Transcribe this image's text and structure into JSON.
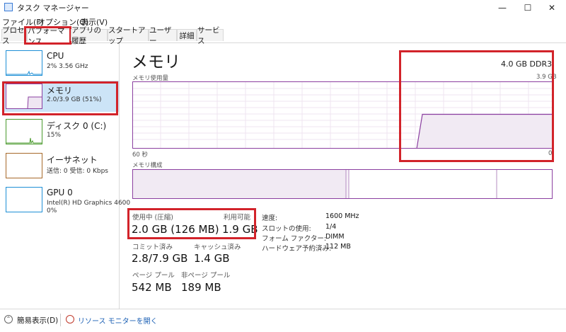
{
  "window": {
    "title": "タスク マネージャー",
    "controls": {
      "minimize": "—",
      "maximize": "☐",
      "close": "✕"
    }
  },
  "menu": [
    "ファイル(F)",
    "オプション(O)",
    "表示(V)"
  ],
  "tabs": [
    {
      "label": "プロセス",
      "active": false
    },
    {
      "label": "パフォーマンス",
      "active": true
    },
    {
      "label": "アプリの履歴",
      "active": false
    },
    {
      "label": "スタートアップ",
      "active": false
    },
    {
      "label": "ユーザー",
      "active": false
    },
    {
      "label": "詳細",
      "active": false
    },
    {
      "label": "サービス",
      "active": false
    }
  ],
  "sidebar": {
    "items": [
      {
        "name": "CPU",
        "detail": "2%  3.56 GHz",
        "detail2": "",
        "color": "#1e8fd6",
        "selected": false
      },
      {
        "name": "メモリ",
        "detail": "2.0/3.9 GB (51%)",
        "detail2": "",
        "color": "#8b3fa0",
        "selected": true
      },
      {
        "name": "ディスク 0 (C:)",
        "detail": "15%",
        "detail2": "",
        "color": "#4a9a2c",
        "selected": false
      },
      {
        "name": "イーサネット",
        "detail": "送信: 0  受信: 0 Kbps",
        "detail2": "",
        "color": "#a7692a",
        "selected": false
      },
      {
        "name": "GPU 0",
        "detail": "Intel(R) HD Graphics 4600",
        "detail2": "0%",
        "color": "#1e8fd6",
        "selected": false
      }
    ]
  },
  "main": {
    "title": "メモリ",
    "spec": "4.0 GB DDR3",
    "usage_graph": {
      "label": "メモリ使用量",
      "max_label": "3.9 GB",
      "time_label": "60 秒",
      "min_label": "0",
      "level_fraction": 0.51
    },
    "composition_graph": {
      "label": "メモリ構成"
    },
    "stats": [
      {
        "label": "使用中 (圧縮)",
        "value": "2.0 GB (126 MB)"
      },
      {
        "label": "利用可能",
        "value": "1.9 GB"
      },
      {
        "label": "コミット済み",
        "value": "2.8/7.9 GB"
      },
      {
        "label": "キャッシュ済み",
        "value": "1.4 GB"
      },
      {
        "label": "ページ プール",
        "value": "542 MB"
      },
      {
        "label": "非ページ プール",
        "value": "189 MB"
      }
    ],
    "details": [
      {
        "label": "速度:",
        "value": "1600 MHz"
      },
      {
        "label": "スロットの使用:",
        "value": "1/4"
      },
      {
        "label": "フォーム ファクター:",
        "value": "DIMM"
      },
      {
        "label": "ハードウェア予約済み:",
        "value": "112 MB"
      }
    ]
  },
  "footer": {
    "fewer_details": "簡易表示(D)",
    "resource_monitor": "リソース モニターを開く"
  },
  "colors": {
    "memory_accent": "#8b3fa0",
    "highlight_red": "#d2232a",
    "selected_bg": "#cce4f7"
  }
}
